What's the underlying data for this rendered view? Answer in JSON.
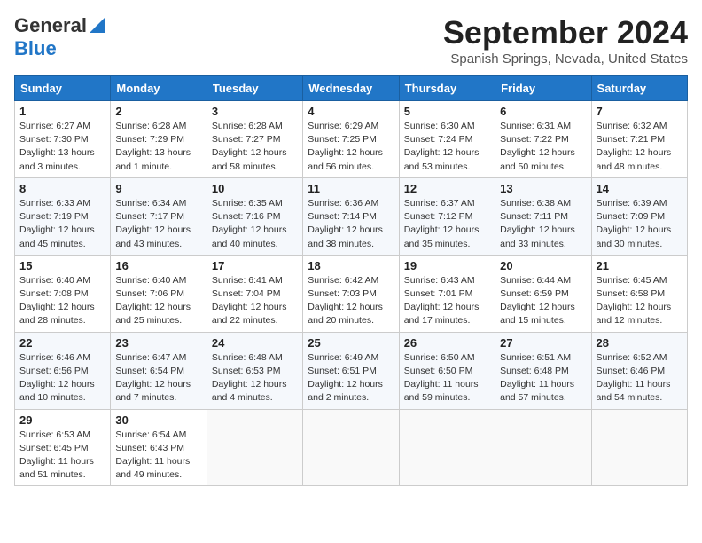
{
  "header": {
    "logo_line1": "General",
    "logo_line2": "Blue",
    "month": "September 2024",
    "location": "Spanish Springs, Nevada, United States"
  },
  "weekdays": [
    "Sunday",
    "Monday",
    "Tuesday",
    "Wednesday",
    "Thursday",
    "Friday",
    "Saturday"
  ],
  "weeks": [
    [
      {
        "day": "1",
        "info": "Sunrise: 6:27 AM\nSunset: 7:30 PM\nDaylight: 13 hours\nand 3 minutes."
      },
      {
        "day": "2",
        "info": "Sunrise: 6:28 AM\nSunset: 7:29 PM\nDaylight: 13 hours\nand 1 minute."
      },
      {
        "day": "3",
        "info": "Sunrise: 6:28 AM\nSunset: 7:27 PM\nDaylight: 12 hours\nand 58 minutes."
      },
      {
        "day": "4",
        "info": "Sunrise: 6:29 AM\nSunset: 7:25 PM\nDaylight: 12 hours\nand 56 minutes."
      },
      {
        "day": "5",
        "info": "Sunrise: 6:30 AM\nSunset: 7:24 PM\nDaylight: 12 hours\nand 53 minutes."
      },
      {
        "day": "6",
        "info": "Sunrise: 6:31 AM\nSunset: 7:22 PM\nDaylight: 12 hours\nand 50 minutes."
      },
      {
        "day": "7",
        "info": "Sunrise: 6:32 AM\nSunset: 7:21 PM\nDaylight: 12 hours\nand 48 minutes."
      }
    ],
    [
      {
        "day": "8",
        "info": "Sunrise: 6:33 AM\nSunset: 7:19 PM\nDaylight: 12 hours\nand 45 minutes."
      },
      {
        "day": "9",
        "info": "Sunrise: 6:34 AM\nSunset: 7:17 PM\nDaylight: 12 hours\nand 43 minutes."
      },
      {
        "day": "10",
        "info": "Sunrise: 6:35 AM\nSunset: 7:16 PM\nDaylight: 12 hours\nand 40 minutes."
      },
      {
        "day": "11",
        "info": "Sunrise: 6:36 AM\nSunset: 7:14 PM\nDaylight: 12 hours\nand 38 minutes."
      },
      {
        "day": "12",
        "info": "Sunrise: 6:37 AM\nSunset: 7:12 PM\nDaylight: 12 hours\nand 35 minutes."
      },
      {
        "day": "13",
        "info": "Sunrise: 6:38 AM\nSunset: 7:11 PM\nDaylight: 12 hours\nand 33 minutes."
      },
      {
        "day": "14",
        "info": "Sunrise: 6:39 AM\nSunset: 7:09 PM\nDaylight: 12 hours\nand 30 minutes."
      }
    ],
    [
      {
        "day": "15",
        "info": "Sunrise: 6:40 AM\nSunset: 7:08 PM\nDaylight: 12 hours\nand 28 minutes."
      },
      {
        "day": "16",
        "info": "Sunrise: 6:40 AM\nSunset: 7:06 PM\nDaylight: 12 hours\nand 25 minutes."
      },
      {
        "day": "17",
        "info": "Sunrise: 6:41 AM\nSunset: 7:04 PM\nDaylight: 12 hours\nand 22 minutes."
      },
      {
        "day": "18",
        "info": "Sunrise: 6:42 AM\nSunset: 7:03 PM\nDaylight: 12 hours\nand 20 minutes."
      },
      {
        "day": "19",
        "info": "Sunrise: 6:43 AM\nSunset: 7:01 PM\nDaylight: 12 hours\nand 17 minutes."
      },
      {
        "day": "20",
        "info": "Sunrise: 6:44 AM\nSunset: 6:59 PM\nDaylight: 12 hours\nand 15 minutes."
      },
      {
        "day": "21",
        "info": "Sunrise: 6:45 AM\nSunset: 6:58 PM\nDaylight: 12 hours\nand 12 minutes."
      }
    ],
    [
      {
        "day": "22",
        "info": "Sunrise: 6:46 AM\nSunset: 6:56 PM\nDaylight: 12 hours\nand 10 minutes."
      },
      {
        "day": "23",
        "info": "Sunrise: 6:47 AM\nSunset: 6:54 PM\nDaylight: 12 hours\nand 7 minutes."
      },
      {
        "day": "24",
        "info": "Sunrise: 6:48 AM\nSunset: 6:53 PM\nDaylight: 12 hours\nand 4 minutes."
      },
      {
        "day": "25",
        "info": "Sunrise: 6:49 AM\nSunset: 6:51 PM\nDaylight: 12 hours\nand 2 minutes."
      },
      {
        "day": "26",
        "info": "Sunrise: 6:50 AM\nSunset: 6:50 PM\nDaylight: 11 hours\nand 59 minutes."
      },
      {
        "day": "27",
        "info": "Sunrise: 6:51 AM\nSunset: 6:48 PM\nDaylight: 11 hours\nand 57 minutes."
      },
      {
        "day": "28",
        "info": "Sunrise: 6:52 AM\nSunset: 6:46 PM\nDaylight: 11 hours\nand 54 minutes."
      }
    ],
    [
      {
        "day": "29",
        "info": "Sunrise: 6:53 AM\nSunset: 6:45 PM\nDaylight: 11 hours\nand 51 minutes."
      },
      {
        "day": "30",
        "info": "Sunrise: 6:54 AM\nSunset: 6:43 PM\nDaylight: 11 hours\nand 49 minutes."
      },
      null,
      null,
      null,
      null,
      null
    ]
  ]
}
